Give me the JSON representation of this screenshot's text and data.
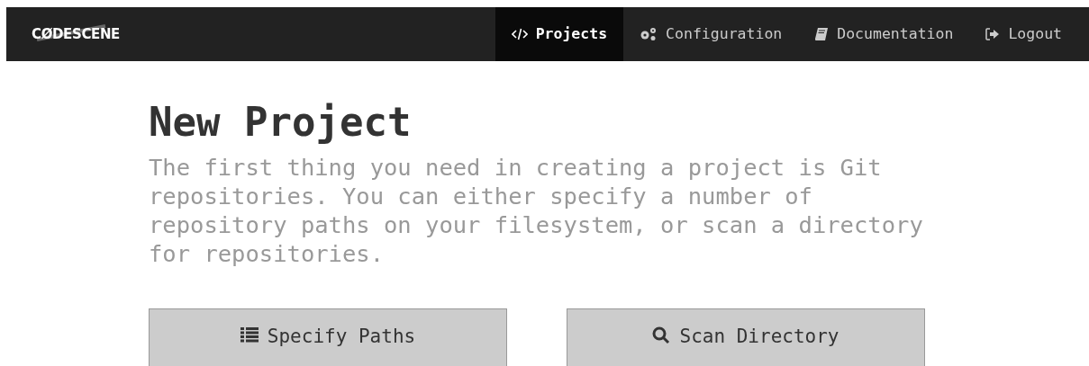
{
  "navbar": {
    "logo": "CØDESCENE",
    "items": [
      {
        "label": "Projects",
        "selected": true
      },
      {
        "label": "Configuration",
        "selected": false
      },
      {
        "label": "Documentation",
        "selected": false
      },
      {
        "label": "Logout",
        "selected": false
      }
    ]
  },
  "heading": "New Project",
  "description": "The first thing you need in creating a project is Git repositories. You can either specify a number of repository paths on your filesystem, or scan a directory for repositories.",
  "buttons": [
    {
      "label": "Specify Paths"
    },
    {
      "label": "Scan Directory"
    }
  ]
}
